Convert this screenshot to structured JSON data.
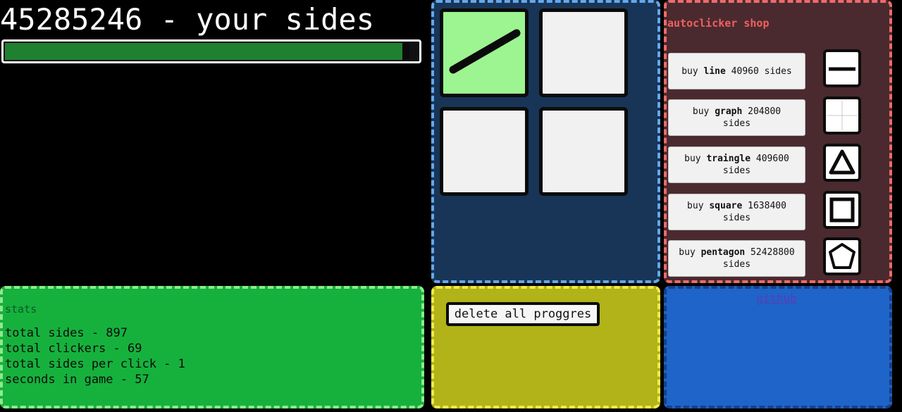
{
  "header": {
    "score_text": "45285246 - your sides",
    "progress": 0.98
  },
  "tiles": [
    {
      "state": "active",
      "icon": "diagonal-line-icon"
    },
    {
      "state": "empty"
    },
    {
      "state": "empty"
    },
    {
      "state": "empty"
    }
  ],
  "shop": {
    "title": "autoclicker shop",
    "items": [
      {
        "prefix": "buy ",
        "name": "line",
        "suffix": " 40960 sides",
        "icon": "line-icon"
      },
      {
        "prefix": "buy ",
        "name": "graph",
        "suffix": " 204800 sides",
        "icon": "graph-icon"
      },
      {
        "prefix": "buy ",
        "name": "traingle",
        "suffix": " 409600 sides",
        "icon": "triangle-icon"
      },
      {
        "prefix": "buy ",
        "name": "square",
        "suffix": " 1638400 sides",
        "icon": "square-icon"
      },
      {
        "prefix": "buy ",
        "name": "pentagon",
        "suffix": " 52428800 sides",
        "icon": "pentagon-icon"
      }
    ]
  },
  "stats": {
    "title": "stats",
    "lines": [
      "total sides - 897",
      "total clickers - 69",
      "total sides per click - 1",
      "seconds in game - 57"
    ]
  },
  "controls": {
    "delete_label": "delete all proggres"
  },
  "links": {
    "github_label": "github"
  },
  "colors": {
    "tiles_panel": "#183558",
    "shop_panel": "#4a2a2f",
    "stats_panel": "#16b13d",
    "delete_panel": "#b1b319",
    "github_panel": "#1f64c8",
    "progress_fill": "#1f8030",
    "active_tile": "#9cf590"
  }
}
